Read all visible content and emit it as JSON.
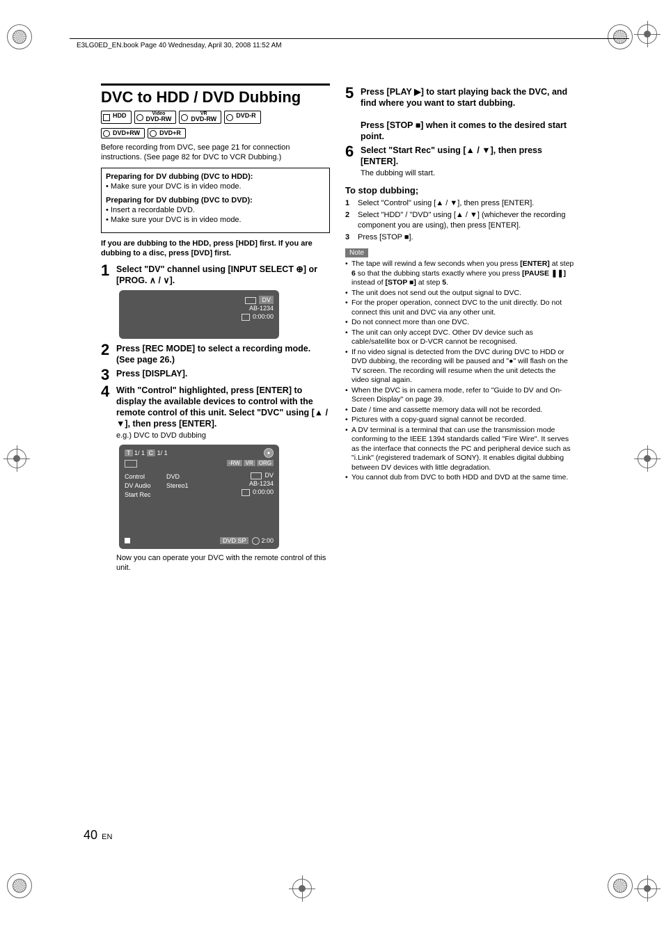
{
  "header": "E3LG0ED_EN.book  Page 40  Wednesday, April 30, 2008  11:52 AM",
  "title": "DVC to HDD / DVD Dubbing",
  "media_icons": {
    "hdd": "HDD",
    "dvdrw_video_sup": "Video",
    "dvdrw_video": "DVD-RW",
    "dvdrw_vr_sup": "VR",
    "dvdrw_vr": "DVD-RW",
    "dvdr": "DVD-R",
    "dvdprw": "DVD+RW",
    "dvdpr": "DVD+R"
  },
  "intro": "Before recording from DVC, see page 21 for connection instructions. (See page 82 for DVC to VCR Dubbing.)",
  "prep": {
    "hdd_title": "Preparing for DV dubbing (DVC to HDD):",
    "hdd_1": "Make sure your DVC is in video mode.",
    "dvd_title": "Preparing for DV dubbing (DVC to DVD):",
    "dvd_1": "Insert a recordable DVD.",
    "dvd_2": "Make sure your DVC is in video mode."
  },
  "warn": "If you are dubbing to the HDD, press [HDD] first. If you are dubbing to a disc, press [DVD] first.",
  "steps": {
    "s1": "Select \"DV\" channel using [INPUT SELECT ⊕] or [PROG. ∧ / ∨].",
    "s2": "Press [REC MODE] to select a recording mode. (See page 26.)",
    "s3": "Press [DISPLAY].",
    "s4": "With \"Control\" highlighted, press [ENTER] to display the available devices to control with the remote control of this unit. Select \"DVC\" using [▲ / ▼], then press [ENTER].",
    "s4_sub": "e.g.) DVC to DVD dubbing",
    "s5a": "Press [PLAY ▶] to start playing back the DVC, and find where you want to start dubbing.",
    "s5b": "Press [STOP ■] when it comes to the desired start point.",
    "s6": "Select \"Start Rec\" using [▲ / ▼], then press [ENTER].",
    "s6_sub": "The dubbing will start."
  },
  "screen1": {
    "dv": "DV",
    "code": "AB-1234",
    "time": "0:00:00"
  },
  "screen2": {
    "t": "T",
    "tc": "1/  1",
    "c": "C",
    "cc": "1/  1",
    "tags": [
      "-RW",
      "VR",
      "ORG"
    ],
    "menu": {
      "control_k": "Control",
      "control_v": "DVD",
      "audio_k": "DV Audio",
      "audio_v": "Stereo1",
      "start_k": "Start Rec"
    },
    "dv": "DV",
    "code": "AB-1234",
    "time": "0:00:00",
    "mode": "DVD SP",
    "remain": "2:00"
  },
  "caption": "Now you can operate your DVC with the remote control of this unit.",
  "stop_head": "To stop dubbing;",
  "stop": {
    "l1": "Select \"Control\" using [▲ / ▼], then press [ENTER].",
    "l2": "Select \"HDD\" / \"DVD\" using [▲ / ▼] (whichever the recording component you are using), then press [ENTER].",
    "l3": "Press [STOP ■]."
  },
  "note_label": "Note",
  "notes": {
    "n1a": "The tape will rewind a few seconds when you press ",
    "n1b": "[ENTER]",
    "n1c": " at step ",
    "n1d": "6",
    "n1e": " so that the dubbing starts exactly where you press ",
    "n1f": "[PAUSE ❚❚]",
    "n1g": " instead of  ",
    "n1h": "[STOP ■]",
    "n1i": " at step ",
    "n1j": "5",
    "n1k": ".",
    "n2": "The unit does not send out the output signal to DVC.",
    "n3": "For the proper operation, connect DVC to the unit directly. Do not connect this unit and DVC via any other unit.",
    "n4": "Do not connect more than one DVC.",
    "n5": "The unit can only accept DVC. Other DV device such as cable/satellite box or D-VCR cannot be recognised.",
    "n6": "If no video signal is detected from the DVC during DVC to HDD or DVD dubbing, the recording will be paused and \"●\" will flash on the TV screen. The recording will resume when the unit detects the video signal again.",
    "n7": "When the DVC is in camera mode, refer to \"Guide to DV and On-Screen Display\" on page 39.",
    "n8": "Date / time and cassette memory data will not be recorded.",
    "n9": "Pictures with a copy-guard signal cannot be recorded.",
    "n10": "A DV terminal is a terminal that can use the transmission mode conforming to the IEEE 1394 standards called \"Fire Wire\". It serves as the interface that connects the PC and peripheral device such as \"i.Link\" (registered trademark of SONY). It enables digital dubbing between DV devices with little degradation.",
    "n11": "You cannot dub from DVC to both HDD and DVD at the same time."
  },
  "page": {
    "num": "40",
    "lang": "EN"
  }
}
